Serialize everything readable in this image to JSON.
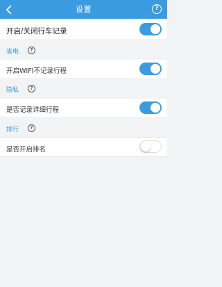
{
  "header": {
    "title": "设置",
    "back_icon": "chevron-left-icon",
    "help_icon": "question-circle-icon",
    "help_glyph": "?"
  },
  "main_toggle": {
    "label": "开启/关闭行车记录",
    "on": true
  },
  "sections": [
    {
      "title": "省电",
      "help_glyph": "?",
      "rows": [
        {
          "label": "开启WIFI不记录行程",
          "on": true
        }
      ]
    },
    {
      "title": "隐私",
      "help_glyph": "?",
      "rows": [
        {
          "label": "是否记录详细行程",
          "on": true
        }
      ]
    },
    {
      "title": "排行",
      "help_glyph": "?",
      "rows": [
        {
          "label": "是否开启排名",
          "on": false
        }
      ]
    }
  ],
  "colors": {
    "accent": "#3a9be0",
    "background": "#f2f3f5"
  }
}
